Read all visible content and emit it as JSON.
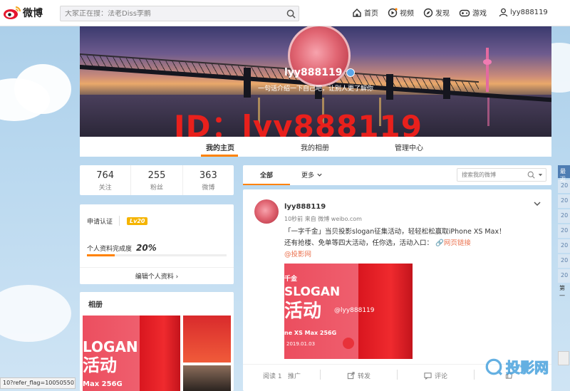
{
  "topbar": {
    "logo_text": "微博",
    "search_placeholder": "大家正在搜：法老Diss李鹏",
    "nav": [
      {
        "label": "首页",
        "icon": "home-icon"
      },
      {
        "label": "视频",
        "icon": "video-icon"
      },
      {
        "label": "发现",
        "icon": "discover-icon"
      },
      {
        "label": "游戏",
        "icon": "game-icon"
      }
    ],
    "username": "lyy888119"
  },
  "cover": {
    "name": "lyy888119",
    "bio": "一句话介绍一下自己吧，让别人更了解你",
    "watermark": "ID：lyy888119"
  },
  "profile_tabs": [
    "我的主页",
    "我的相册",
    "管理中心"
  ],
  "stats": [
    {
      "num": "764",
      "label": "关注"
    },
    {
      "num": "255",
      "label": "粉丝"
    },
    {
      "num": "363",
      "label": "微博"
    }
  ],
  "cert": {
    "label": "申请认证",
    "level": "Lv20",
    "progress_label": "个人资料完成度",
    "progress_pct": "20%",
    "progress_value": 0.2,
    "edit_label": "编辑个人资料"
  },
  "album": {
    "title": "相册"
  },
  "album_texts": {
    "slogan": "LOGAN",
    "huodong": "活动",
    "model": "Max 256G"
  },
  "feed": {
    "tab_all": "全部",
    "tab_more": "更多",
    "search_placeholder": "搜索我的微博"
  },
  "post": {
    "name": "lyy888119",
    "meta": "10秒前 来自 微博 weibo.com",
    "line1": "「一字千金」当贝投影slogan征集活动，轻轻松松赢取iPhone XS Max！",
    "line2": "还有抢楼、免单等四大活动，任你选，活动入口：",
    "link": "网页链接",
    "mention": "@投影网",
    "image": {
      "corner": "千金",
      "slogan": "SLOGAN",
      "huodong": "活动",
      "watermark": "@lyy888119",
      "model": "ne XS Max 256G",
      "date": "2019.01.03"
    },
    "actions": [
      {
        "label": "阅读 1",
        "icon": ""
      },
      {
        "label": "推广",
        "icon": ""
      },
      {
        "label": "转发",
        "icon": "share-icon"
      },
      {
        "label": "评论",
        "icon": "comment-icon"
      },
      {
        "label": "",
        "icon": "like-icon"
      }
    ]
  },
  "rail": {
    "head": "最近",
    "items": [
      "20",
      "20",
      "20",
      "20",
      "20",
      "20",
      "20"
    ],
    "foot": "第一"
  },
  "status_url": "10?refer_flag=1005055010_",
  "site_mark": "投影网",
  "colors": {
    "accent": "#ff8200",
    "link": "#eb7350",
    "watermark_red": "#e8201c"
  }
}
